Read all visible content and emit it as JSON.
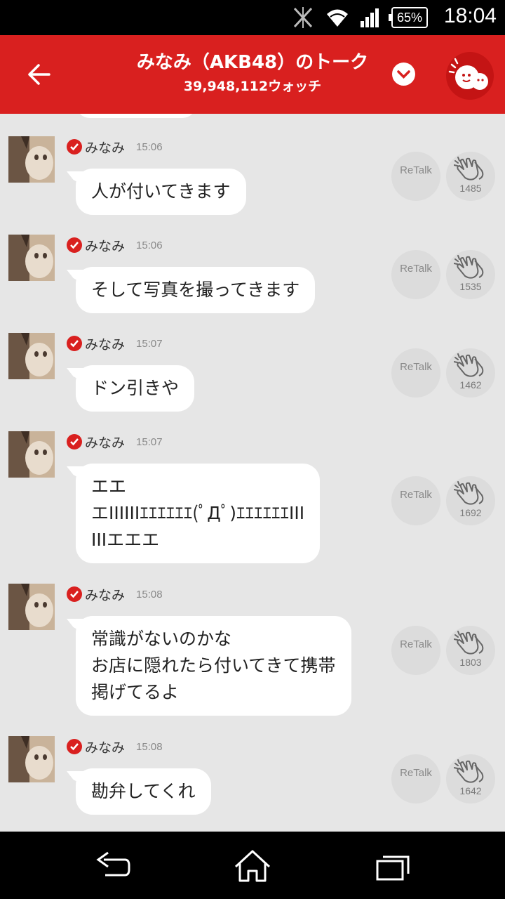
{
  "status_bar": {
    "battery": "65%",
    "time": "18:04",
    "icons": [
      "signal-blocked-icon",
      "wifi-icon",
      "cellular-signal-icon",
      "battery-icon"
    ]
  },
  "header": {
    "title": "みなみ（AKB48）のトーク",
    "watch_count": "39,948,112ウォッチ",
    "icons": [
      "back-arrow-icon",
      "chevron-down-icon",
      "mascot-icon"
    ]
  },
  "messages": [
    {
      "name": "みなみ",
      "time": "15:06",
      "text": "人が付いてきます",
      "retalk": "ReTalk",
      "claps": "1485"
    },
    {
      "name": "みなみ",
      "time": "15:06",
      "text": "そして写真を撮ってきます",
      "retalk": "ReTalk",
      "claps": "1535"
    },
    {
      "name": "みなみ",
      "time": "15:07",
      "text": "ドン引きや",
      "retalk": "ReTalk",
      "claps": "1462"
    },
    {
      "name": "みなみ",
      "time": "15:07",
      "text": "エエ\nエIIIIIIｴｴｴｴｴｴ(ﾟДﾟ)ｴｴｴｴｴｴIII\nIIIエエエ",
      "retalk": "ReTalk",
      "claps": "1692"
    },
    {
      "name": "みなみ",
      "time": "15:08",
      "text": "常識がないのかな\nお店に隠れたら付いてきて携帯\n掲げてるよ",
      "retalk": "ReTalk",
      "claps": "1803"
    },
    {
      "name": "みなみ",
      "time": "15:08",
      "text": "勘弁してくれ",
      "retalk": "ReTalk",
      "claps": "1642"
    }
  ],
  "nav_bar": {
    "icons": [
      "back-icon",
      "home-icon",
      "recent-apps-icon"
    ]
  },
  "colors": {
    "header": "#d9201f",
    "background": "#e6e6e6",
    "bubble": "#ffffff",
    "verified_badge": "#d9201f"
  }
}
